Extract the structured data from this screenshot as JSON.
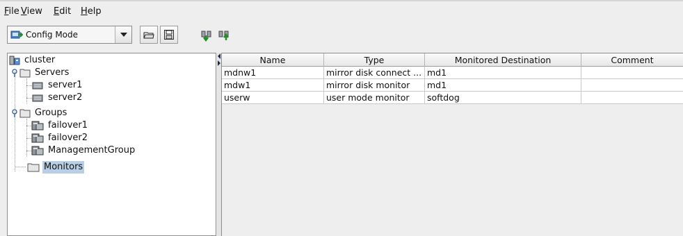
{
  "menu": {
    "items": [
      {
        "mnemonic": "F",
        "rest": "ile"
      },
      {
        "mnemonic": "V",
        "rest": "iew"
      },
      {
        "mnemonic": "E",
        "rest": "dit"
      },
      {
        "mnemonic": "H",
        "rest": "elp"
      }
    ]
  },
  "toolbar": {
    "mode_select": {
      "value": "Config Mode",
      "icon": "config-mode-icon"
    },
    "buttons": [
      {
        "icon": "open-folder-icon"
      },
      {
        "icon": "save-disk-icon"
      },
      {
        "icon": "download-config-icon"
      },
      {
        "icon": "upload-config-icon"
      }
    ]
  },
  "tree": {
    "root": "cluster",
    "servers_label": "Servers",
    "servers": [
      "server1",
      "server2"
    ],
    "groups_label": "Groups",
    "groups": [
      "failover1",
      "failover2",
      "ManagementGroup"
    ],
    "monitors_label": "Monitors",
    "selected": "Monitors"
  },
  "table": {
    "columns": [
      "Name",
      "Type",
      "Monitored Destination",
      "Comment"
    ],
    "rows": [
      [
        "mdnw1",
        "mirror disk connect ...",
        "md1",
        ""
      ],
      [
        "mdw1",
        "mirror disk monitor",
        "md1",
        ""
      ],
      [
        "userw",
        "user mode monitor",
        "softdog",
        ""
      ]
    ]
  }
}
